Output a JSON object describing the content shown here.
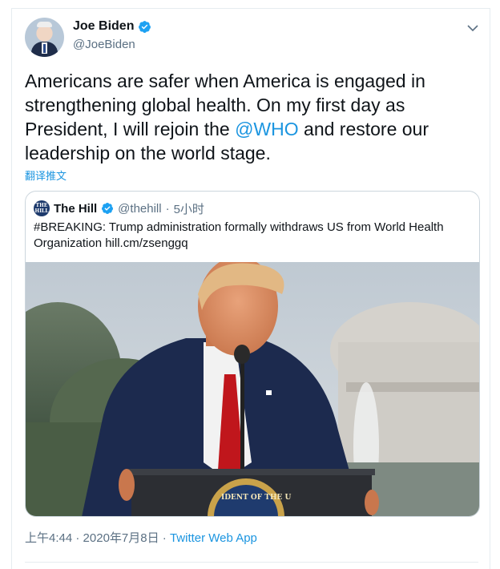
{
  "author": {
    "name": "Joe Biden",
    "handle": "@JoeBiden",
    "verified_icon": "verified-badge-icon"
  },
  "tweet": {
    "text_before": "Americans are safer when America is engaged in strengthening global health. On my first day as President, I will rejoin the ",
    "mention": "@WHO",
    "text_after": " and restore our leadership on the world stage.",
    "translate_label": "翻译推文"
  },
  "quoted": {
    "logo_text": "THE HILL",
    "name": "The Hill",
    "handle": "@thehill",
    "separator": "·",
    "time": "5小时",
    "text": "#BREAKING: Trump administration formally withdraws US from World Health Organization hill.cm/zsenggq",
    "seal_text": "IDENT OF THE U"
  },
  "meta": {
    "time": "上午4:44",
    "sep1": " · ",
    "date": "2020年7月8日",
    "sep2": " · ",
    "source": "Twitter Web App"
  },
  "colors": {
    "accent": "#1b95e0",
    "secondary_text": "#5b7083",
    "border": "#ccd6dd"
  }
}
